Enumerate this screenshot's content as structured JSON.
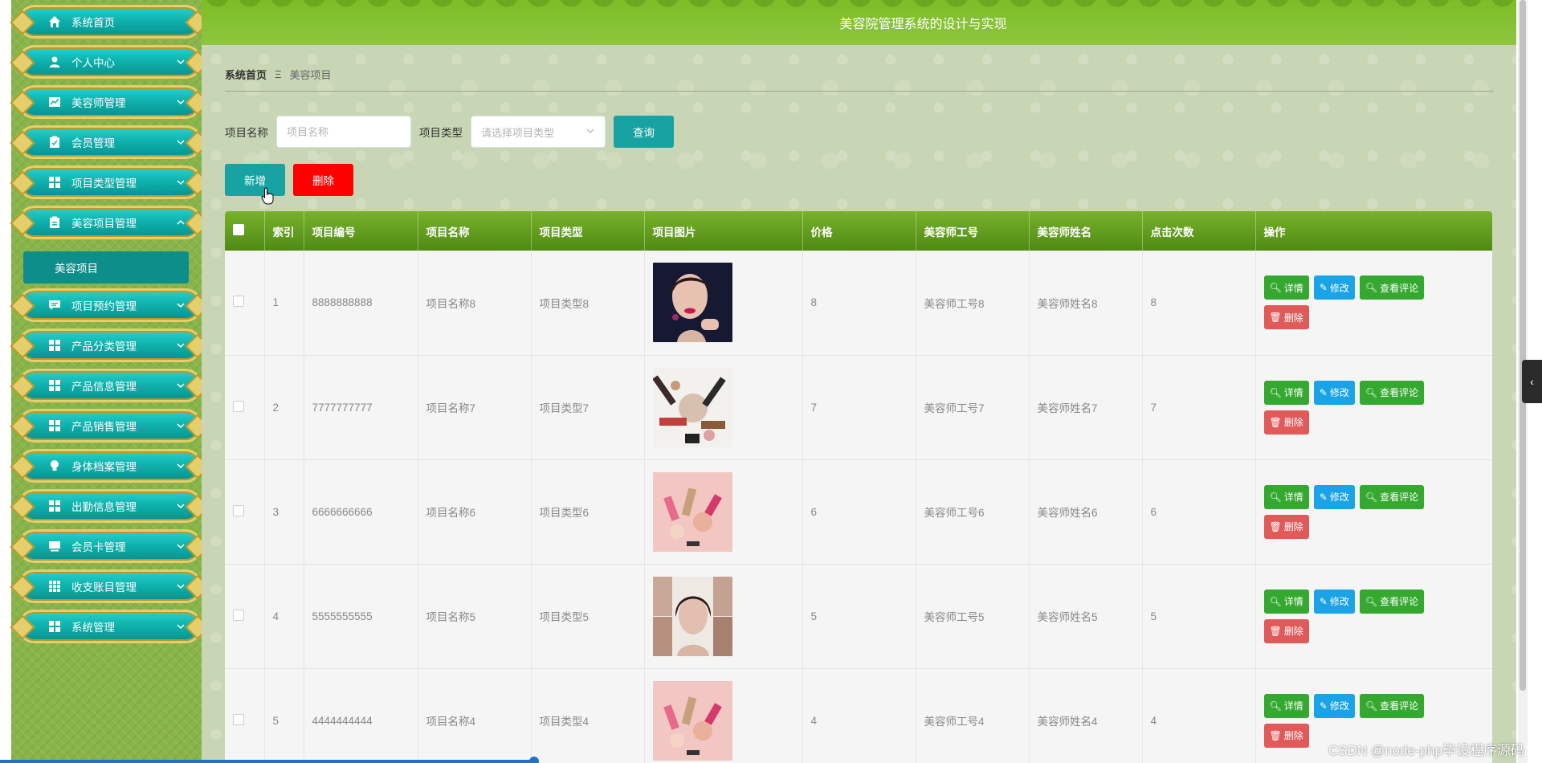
{
  "header": {
    "title": "美容院管理系统的设计与实现"
  },
  "sidebar": {
    "items": [
      {
        "label": "系统首页",
        "icon": "home-icon"
      },
      {
        "label": "个人中心",
        "icon": "user-icon"
      },
      {
        "label": "美容师管理",
        "icon": "chart-icon"
      },
      {
        "label": "会员管理",
        "icon": "clipboard-icon"
      },
      {
        "label": "项目类型管理",
        "icon": "grid-icon"
      },
      {
        "label": "美容项目管理",
        "icon": "clipboard-icon"
      },
      {
        "label": "项目预约管理",
        "icon": "message-icon"
      },
      {
        "label": "产品分类管理",
        "icon": "grid-icon"
      },
      {
        "label": "产品信息管理",
        "icon": "grid-icon"
      },
      {
        "label": "产品销售管理",
        "icon": "grid-icon"
      },
      {
        "label": "身体档案管理",
        "icon": "bulb-icon"
      },
      {
        "label": "出勤信息管理",
        "icon": "grid-icon"
      },
      {
        "label": "会员卡管理",
        "icon": "monitor-icon"
      },
      {
        "label": "收支账目管理",
        "icon": "table-icon"
      },
      {
        "label": "系统管理",
        "icon": "grid-icon"
      }
    ],
    "submenu": {
      "label": "美容项目"
    }
  },
  "breadcrumb": {
    "home": "系统首页",
    "separator": "Ξ",
    "current": "美容项目"
  },
  "search": {
    "name_label": "项目名称",
    "name_placeholder": "项目名称",
    "type_label": "项目类型",
    "type_placeholder": "请选择项目类型",
    "query_button": "查询"
  },
  "actions": {
    "add": "新增",
    "delete": "删除"
  },
  "table": {
    "columns": [
      "索引",
      "项目编号",
      "项目名称",
      "项目类型",
      "项目图片",
      "价格",
      "美容师工号",
      "美容师姓名",
      "点击次数",
      "操作"
    ],
    "rows": [
      {
        "index": "1",
        "code": "8888888888",
        "name": "项目名称8",
        "type": "项目类型8",
        "price": "8",
        "staff_no": "美容师工号8",
        "staff_name": "美容师姓名8",
        "clicks": "8"
      },
      {
        "index": "2",
        "code": "7777777777",
        "name": "项目名称7",
        "type": "项目类型7",
        "price": "7",
        "staff_no": "美容师工号7",
        "staff_name": "美容师姓名7",
        "clicks": "7"
      },
      {
        "index": "3",
        "code": "6666666666",
        "name": "项目名称6",
        "type": "项目类型6",
        "price": "6",
        "staff_no": "美容师工号6",
        "staff_name": "美容师姓名6",
        "clicks": "6"
      },
      {
        "index": "4",
        "code": "5555555555",
        "name": "项目名称5",
        "type": "项目类型5",
        "price": "5",
        "staff_no": "美容师工号5",
        "staff_name": "美容师姓名5",
        "clicks": "5"
      },
      {
        "index": "5",
        "code": "4444444444",
        "name": "项目名称4",
        "type": "项目类型4",
        "price": "4",
        "staff_no": "美容师工号4",
        "staff_name": "美容师姓名4",
        "clicks": "4"
      }
    ],
    "ops": {
      "detail": "详情",
      "edit": "修改",
      "review": "查看评论",
      "delete": "删除"
    }
  },
  "watermark": "CSDN @node-php毕设程序源码",
  "colors": {
    "teal": "#18a2a2",
    "green_header": "#7cbd27",
    "danger": "#ff0000"
  }
}
